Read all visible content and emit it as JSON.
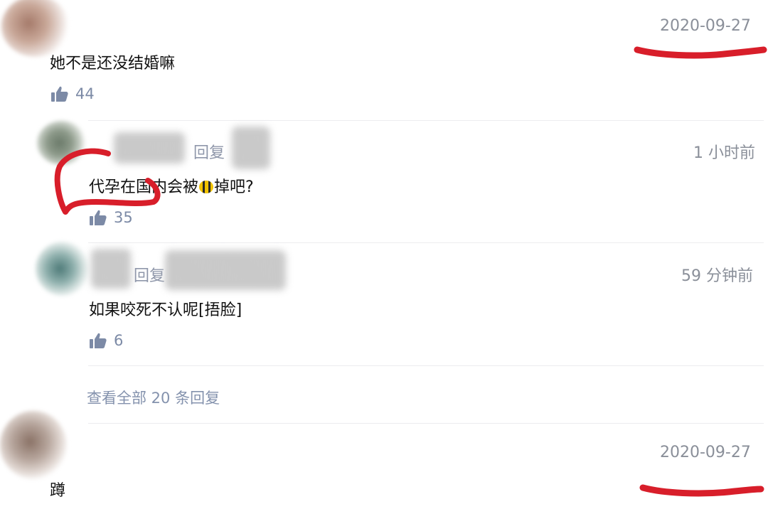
{
  "comments": [
    {
      "timestamp": "2020-09-27",
      "text": "她不是还没结婚嘛",
      "likes": "44",
      "replies": [
        {
          "reply_label": "回复",
          "timestamp": "1 小时前",
          "text_before": "代孕在国内会被",
          "text_after": "掉吧?",
          "emoji": "bee",
          "likes": "35"
        },
        {
          "reply_label": "回复",
          "timestamp": "59 分钟前",
          "text": "如果咬死不认呢[捂脸]",
          "likes": "6"
        }
      ],
      "view_all_replies": "查看全部 20 条回复"
    },
    {
      "timestamp": "2020-09-27",
      "text": "蹲"
    }
  ],
  "colors": {
    "annotation_red": "#d81e2a",
    "meta_gray": "#8a8f99",
    "link_blue_gray": "#8492ad"
  },
  "icons": {
    "like": "thumbs-up-icon"
  }
}
